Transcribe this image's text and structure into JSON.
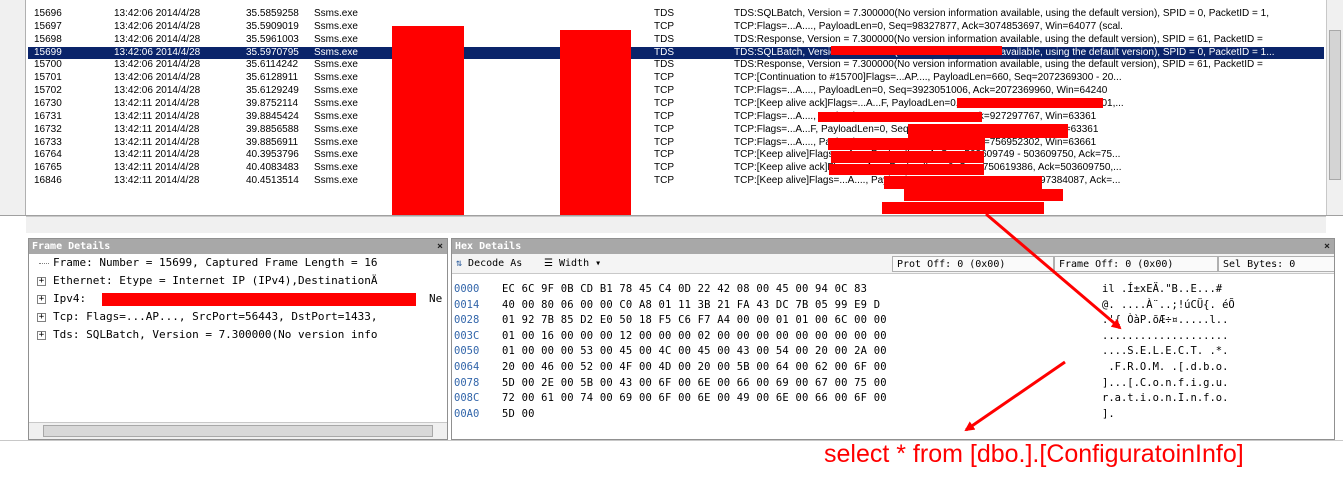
{
  "frames": [
    {
      "num": "15696",
      "time": "13:42:06 2014/4/28",
      "offset": "35.5859258",
      "process": "Ssms.exe",
      "protocol": "TDS",
      "desc": "TDS:SQLBatch, Version = 7.300000(No version information available, using the default version), SPID = 0, PacketID = 1,"
    },
    {
      "num": "15697",
      "time": "13:42:06 2014/4/28",
      "offset": "35.5909019",
      "process": "Ssms.exe",
      "protocol": "TCP",
      "desc": "TCP:Flags=...A...., PayloadLen=0, Seq=98327877, Ack=3074853697, Win=64077 (scal."
    },
    {
      "num": "15698",
      "time": "13:42:06 2014/4/28",
      "offset": "35.5961003",
      "process": "Ssms.exe",
      "protocol": "TDS",
      "desc": "TDS:Response, Version = 7.300000(No version information available, using the default version), SPID = 61, PacketID ="
    },
    {
      "num": "15699",
      "time": "13:42:06 2014/4/28",
      "offset": "35.5970795",
      "process": "Ssms.exe",
      "protocol": "TDS",
      "desc": "TDS:SQLBatch, Version = 7.300000(No version information available, using the default version), SPID = 0, PacketID = 1...",
      "selected": true
    },
    {
      "num": "15700",
      "time": "13:42:06 2014/4/28",
      "offset": "35.6114242",
      "process": "Ssms.exe",
      "protocol": "TDS",
      "desc": "TDS:Response, Version = 7.300000(No version information available, using the default version), SPID = 61, PacketID ="
    },
    {
      "num": "15701",
      "time": "13:42:06 2014/4/28",
      "offset": "35.6128911",
      "process": "Ssms.exe",
      "protocol": "TCP",
      "desc": "TCP:[Continuation to #15700]Flags=...AP...., PayloadLen=660, Seq=2072369300 - 20..."
    },
    {
      "num": "15702",
      "time": "13:42:06 2014/4/28",
      "offset": "35.6129249",
      "process": "Ssms.exe",
      "protocol": "TCP",
      "desc": "TCP:Flags=...A...., PayloadLen=0, Seq=3923051006, Ack=2072369960, Win=64240"
    },
    {
      "num": "16730",
      "time": "13:42:11 2014/4/28",
      "offset": "39.8752114",
      "process": "Ssms.exe",
      "protocol": "TCP",
      "desc": "TCP:[Keep alive ack]Flags=...A...F, PayloadLen=0, Seq=927297766, Ack=756952301,..."
    },
    {
      "num": "16731",
      "time": "13:42:11 2014/4/28",
      "offset": "39.8845424",
      "process": "Ssms.exe",
      "protocol": "TCP",
      "desc": "TCP:Flags=...A...., PayloadLen=0, Seq=756952301, Ack=927297767, Win=63361"
    },
    {
      "num": "16732",
      "time": "13:42:11 2014/4/28",
      "offset": "39.8856588",
      "process": "Ssms.exe",
      "protocol": "TCP",
      "desc": "TCP:Flags=...A...F, PayloadLen=0, Seq=756952301, Ack=927297767, Win=63361"
    },
    {
      "num": "16733",
      "time": "13:42:11 2014/4/28",
      "offset": "39.8856911",
      "process": "Ssms.exe",
      "protocol": "TCP",
      "desc": "TCP:Flags=...A...., PayloadLen=0, Seq=927297767, Ack=756952302, Win=63661"
    },
    {
      "num": "16764",
      "time": "13:42:11 2014/4/28",
      "offset": "40.3953796",
      "process": "Ssms.exe",
      "protocol": "TCP",
      "desc": "TCP:[Keep alive]Flags=...A...., PayloadLen=1, Seq=503609749 - 503609750, Ack=75..."
    },
    {
      "num": "16765",
      "time": "13:42:11 2014/4/28",
      "offset": "40.4083483",
      "process": "Ssms.exe",
      "protocol": "TCP",
      "desc": "TCP:[Keep alive ack]Flags=...A...., PayloadLen=0, Seq=750619386, Ack=503609750,..."
    },
    {
      "num": "16846",
      "time": "13:42:11 2014/4/28",
      "offset": "40.4513514",
      "process": "Ssms.exe",
      "protocol": "TCP",
      "desc": "TCP:[Keep alive]Flags=...A...., PayloadLen=1, Seq=1997384086 - 1997384087, Ack=..."
    }
  ],
  "frame_details": {
    "title": "Frame Details",
    "close": "×",
    "rows": [
      {
        "text": "Frame: Number = 15699, Captured Frame Length = 16",
        "expandable": false
      },
      {
        "text": "Ethernet: Etype = Internet IP (IPv4),DestinationÄ",
        "expandable": true
      },
      {
        "text": "Ipv4:",
        "suffix": "Ne",
        "expandable": true
      },
      {
        "text": "Tcp: Flags=...AP..., SrcPort=56443, DstPort=1433,",
        "expandable": true
      },
      {
        "text": "Tds: SQLBatch, Version = 7.300000(No version info",
        "expandable": true
      }
    ]
  },
  "hex_details": {
    "title": "Hex Details",
    "close": "×",
    "decode_as": "Decode As",
    "width": "Width",
    "prot_off": "Prot Off: 0 (0x00)",
    "frame_off": "Frame Off: 0 (0x00)",
    "sel_bytes": "Sel Bytes: 0",
    "lines": [
      {
        "offset": "0000",
        "bytes": "EC 6C 9F 0B CD B1 78 45 C4 0D 22 42 08 00 45 00 94 0C 83",
        "ascii": "il .Í±xEÄ.\"B..E...#"
      },
      {
        "offset": "0014",
        "bytes": "40 00 80 06 00 00 C0 A8 01 11 3B 21 FA 43 DC 7B 05 99 E9 D",
        "ascii": "@. ....À¨..;!úCÜ{. éÕ"
      },
      {
        "offset": "0028",
        "bytes": "01 92 7B 85 D2 E0 50 18 F5 C6 F7 A4 00 00 01 01 00 6C 00 00",
        "ascii": ".'{ ÒàP.õÆ÷¤.....l.."
      },
      {
        "offset": "003C",
        "bytes": "01 00 16 00 00 00 12 00 00 00 02 00 00 00 00 00 00 00 00 00",
        "ascii": "...................."
      },
      {
        "offset": "0050",
        "bytes": "01 00 00 00 53 00 45 00 4C 00 45 00 43 00 54 00 20 00 2A 00",
        "ascii": "....S.E.L.E.C.T. .*."
      },
      {
        "offset": "0064",
        "bytes": "20 00 46 00 52 00 4F 00 4D 00 20 00 5B 00 64 00 62 00 6F 00",
        "ascii": " .F.R.O.M. .[.d.b.o."
      },
      {
        "offset": "0078",
        "bytes": "5D 00 2E 00 5B 00 43 00 6F 00 6E 00 66 00 69 00 67 00 75 00",
        "ascii": "]...[.C.o.n.f.i.g.u."
      },
      {
        "offset": "008C",
        "bytes": "72 00 61 00 74 00 69 00 6F 00 6E 00 49 00 6E 00 66 00 6F 00",
        "ascii": "r.a.t.i.o.n.I.n.f.o."
      },
      {
        "offset": "00A0",
        "bytes": "5D 00",
        "ascii": "]."
      }
    ]
  },
  "annotation": {
    "text": "select * from [dbo.].[ConfiguratoinInfo]",
    "color": "#ff0000"
  },
  "colors": {
    "selected_row": "#0a246a",
    "redaction": "#ff0000",
    "hex_offset": "#3366aa"
  }
}
